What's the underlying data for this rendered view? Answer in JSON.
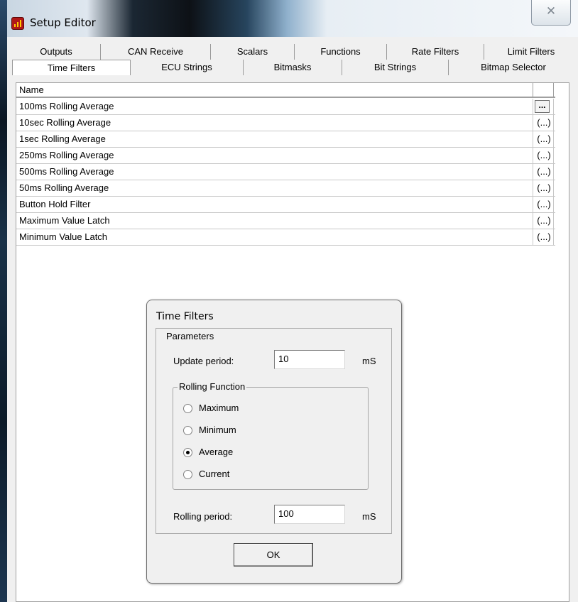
{
  "window": {
    "title": "Setup Editor",
    "close_glyph": "✕"
  },
  "tabs_row1": [
    "Outputs",
    "CAN Receive",
    "Scalars",
    "Functions",
    "Rate Filters",
    "Limit Filters"
  ],
  "tabs_row2": [
    "Time Filters",
    "ECU Strings",
    "Bitmasks",
    "Bit Strings",
    "Bitmap Selector"
  ],
  "active_tab": "Time Filters",
  "grid": {
    "header": "Name",
    "rows": [
      {
        "name": "100ms Rolling Average",
        "action": "..."
      },
      {
        "name": "10sec Rolling Average",
        "action": "(...)"
      },
      {
        "name": "1sec Rolling Average",
        "action": "(...)"
      },
      {
        "name": "250ms Rolling Average",
        "action": "(...)"
      },
      {
        "name": "500ms Rolling Average",
        "action": "(...)"
      },
      {
        "name": "50ms Rolling Average",
        "action": "(...)"
      },
      {
        "name": "Button Hold Filter",
        "action": "(...)"
      },
      {
        "name": "Maximum Value Latch",
        "action": "(...)"
      },
      {
        "name": "Minimum Value Latch",
        "action": "(...)"
      }
    ]
  },
  "dialog": {
    "title": "Time Filters",
    "parameters_legend": "Parameters",
    "update_period_label": "Update period:",
    "update_period_value": "10",
    "update_period_unit": "mS",
    "rolling_function_legend": "Rolling Function",
    "options": [
      "Maximum",
      "Minimum",
      "Average",
      "Current"
    ],
    "selected_option": "Average",
    "rolling_period_label": "Rolling period:",
    "rolling_period_value": "100",
    "rolling_period_unit": "mS",
    "ok_label": "OK"
  }
}
